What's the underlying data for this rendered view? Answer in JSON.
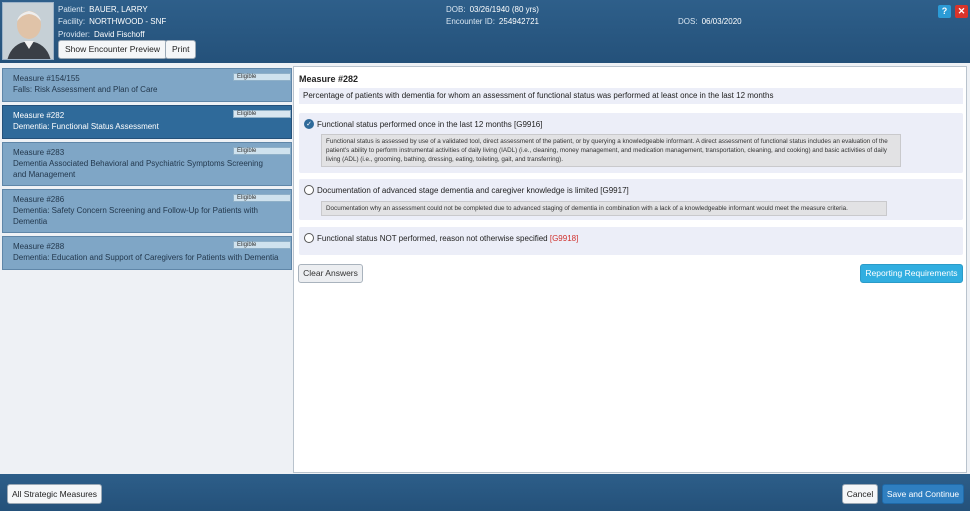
{
  "header": {
    "patient_label": "Patient:",
    "patient": "BAUER, LARRY",
    "facility_label": "Facility:",
    "facility": "NORTHWOOD - SNF",
    "provider_label": "Provider:",
    "provider": "David Fischoff",
    "dob_label": "DOB:",
    "dob": "03/26/1940 (80 yrs)",
    "encounter_label": "Encounter ID:",
    "encounter_id": "254942721",
    "dos_label": "DOS:",
    "dos": "06/03/2020",
    "show_preview_btn": "Show Encounter Preview",
    "print_btn": "Print",
    "help_icon": "?",
    "close_icon": "✕"
  },
  "measures": [
    {
      "number": "Measure #154/155",
      "name": "Falls: Risk Assessment and Plan of Care",
      "badge": "Eligible"
    },
    {
      "number": "Measure #282",
      "name": "Dementia: Functional Status Assessment",
      "badge": "Eligible"
    },
    {
      "number": "Measure #283",
      "name": "Dementia Associated Behavioral and Psychiatric Symptoms Screening and Management",
      "badge": "Eligible"
    },
    {
      "number": "Measure #286",
      "name": "Dementia: Safety Concern Screening and Follow-Up for Patients with Dementia",
      "badge": "Eligible"
    },
    {
      "number": "Measure #288",
      "name": "Dementia: Education and Support of Caregivers for Patients with Dementia",
      "badge": "Eligible"
    }
  ],
  "detail": {
    "title": "Measure #282",
    "description": "Percentage of patients with dementia for whom an assessment of functional status was performed at least once in the last 12 months",
    "options": [
      {
        "label": "Functional status performed once in the last 12 months [G9916]",
        "code": "",
        "desc": "Functional status is assessed by use of a validated tool, direct assessment of the patient, or by querying a knowledgeable informant. A direct assessment of functional status includes an evaluation of the patient's ability to perform instrumental activities of daily living (IADL) (i.e., cleaning, money management, and medication management, transportation, cleaning, and cooking) and basic activities of daily living (ADL) (i.e., grooming, bathing, dressing, eating, toileting, gait, and transferring).",
        "checked": true
      },
      {
        "label": "Documentation of advanced stage dementia and caregiver knowledge is limited [G9917]",
        "code": "",
        "desc": "Documentation why an assessment could not be completed due to advanced staging of dementia in combination with a lack of a knowledgeable informant would meet the measure criteria.",
        "checked": false
      },
      {
        "label": "Functional status NOT performed, reason not otherwise specified ",
        "code": "[G9918]",
        "desc": "",
        "checked": false
      }
    ],
    "clear_btn": "Clear Answers",
    "reporting_btn": "Reporting Requirements"
  },
  "footer": {
    "all_measures_btn": "All Strategic Measures",
    "cancel_btn": "Cancel",
    "save_btn": "Save and Continue"
  },
  "colors": {
    "accent": "#2f6a9a",
    "reporting": "#31aee0",
    "red_code": "#d0312d"
  }
}
